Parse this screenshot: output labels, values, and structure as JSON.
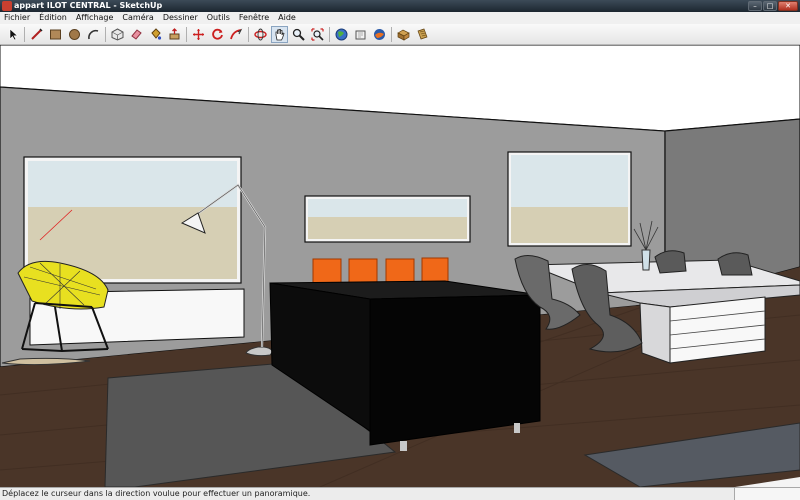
{
  "window": {
    "title": "appart ILOT CENTRAL - SketchUp",
    "minimize_glyph": "–",
    "maximize_glyph": "□",
    "close_glyph": "✕"
  },
  "menu": {
    "items": [
      "Fichier",
      "Édition",
      "Affichage",
      "Caméra",
      "Dessiner",
      "Outils",
      "Fenêtre",
      "Aide"
    ]
  },
  "toolbar": {
    "tools": [
      "select-icon",
      "line-icon",
      "rectangle-icon",
      "circle-icon",
      "arc-icon",
      "make-component-icon",
      "eraser-icon",
      "paint-bucket-icon",
      "push-pull-icon",
      "move-icon",
      "rotate-icon",
      "follow-me-icon",
      "orbit-icon",
      "pan-icon",
      "zoom-icon",
      "zoom-extents-icon",
      "get-models-icon",
      "share-model-icon",
      "google-earth-icon",
      "components-icon",
      "materials-icon"
    ]
  },
  "status": {
    "message": "Déplacez le curseur dans la direction voulue pour effectuer un panoramique."
  },
  "colors": {
    "sky": "#c8dcdc",
    "wall": "#9a9a9a",
    "floor": "#4a3528",
    "rug": "#555555",
    "sofa": "#0a0a0a",
    "chair_accent": "#e8e020",
    "cushion": "#f06818"
  }
}
